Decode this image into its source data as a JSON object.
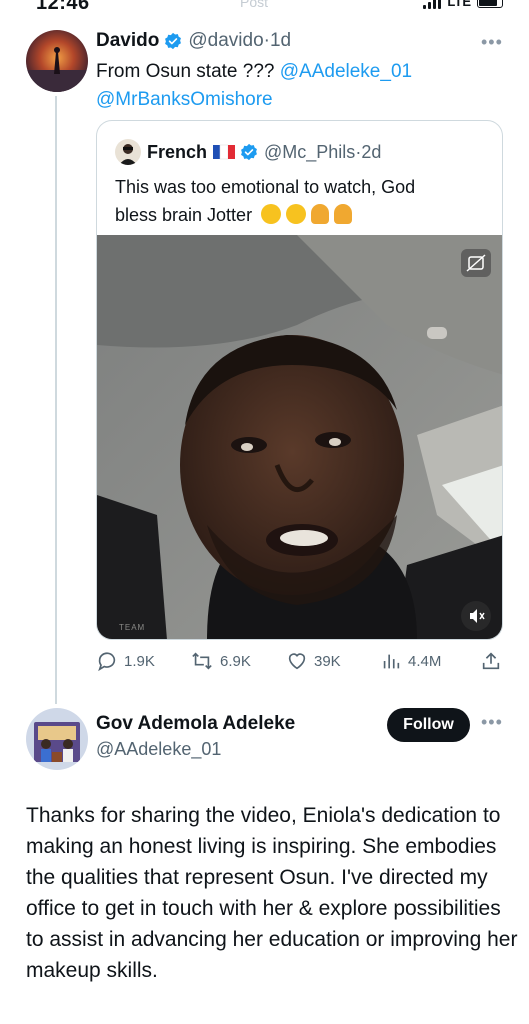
{
  "status_bar": {
    "time": "12:46",
    "center_label": "Post",
    "network": "LTE"
  },
  "tweet1": {
    "name": "Davido",
    "handle": "@davido",
    "separator": "·",
    "time": "1d",
    "text_prefix": "From Osun state ??? ",
    "mention1": "@AAdeleke_01",
    "mention2": "@MrBanksOmishore",
    "more": "•••"
  },
  "quote": {
    "name": "French",
    "handle": "@Mc_Phils",
    "separator": "·",
    "time": "2d",
    "text_line1": "This was too emotional to watch, God",
    "text_line2": "bless brain Jotter",
    "watermark": "ТЕАМ"
  },
  "actions": {
    "replies": "1.9K",
    "reposts": "6.9K",
    "likes": "39K",
    "views": "4.4M"
  },
  "tweet2": {
    "name": "Gov Ademola Adeleke",
    "handle": "@AAdeleke_01",
    "follow_label": "Follow",
    "more": "•••",
    "body": "Thanks for sharing the video, Eniola's dedication to making an honest living is inspiring. She embodies the qualities that represent Osun. I've directed my office to get in touch with her & explore possibilities to assist in advancing her education or improving her makeup skills."
  },
  "colors": {
    "accent": "#1d9bf0",
    "text": "#0f1419",
    "muted": "#536471",
    "border": "#cfd9de"
  }
}
